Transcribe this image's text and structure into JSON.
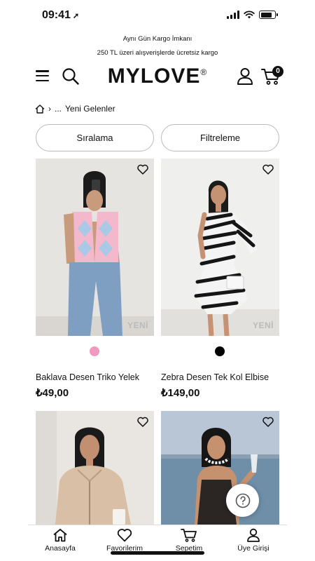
{
  "status_bar": {
    "time": "09:41"
  },
  "promo": {
    "line1": "Aynı Gün Kargo İmkanı",
    "line2": "250 TL üzeri alışverişlerde ücretsiz kargo"
  },
  "header": {
    "logo": "MYLOVE",
    "logo_mark": "®",
    "cart_count": "0"
  },
  "breadcrumb": {
    "separator": "›",
    "ellipsis": "...",
    "current": "Yeni Gelenler"
  },
  "controls": {
    "sort_label": "Sıralama",
    "filter_label": "Filtreleme"
  },
  "products": [
    {
      "name": "Baklava Desen Triko Yelek",
      "price": "₺49,00",
      "badge": "YENİ",
      "swatch_color": "#f19ac0"
    },
    {
      "name": "Zebra Desen Tek Kol Elbise",
      "price": "₺149,00",
      "badge": "YENİ",
      "swatch_color": "#000000"
    },
    {
      "name": "",
      "price": "",
      "badge": "",
      "swatch_color": ""
    },
    {
      "name": "",
      "price": "",
      "badge": "",
      "swatch_color": ""
    }
  ],
  "help_button": {
    "icon": "question-icon"
  },
  "tab_bar": {
    "items": [
      {
        "label": "Anasayfa",
        "icon": "home-icon"
      },
      {
        "label": "Favorilerim",
        "icon": "heart-icon"
      },
      {
        "label": "Sepetim",
        "icon": "cart-icon"
      },
      {
        "label": "Üye Girişi",
        "icon": "user-icon"
      }
    ]
  }
}
